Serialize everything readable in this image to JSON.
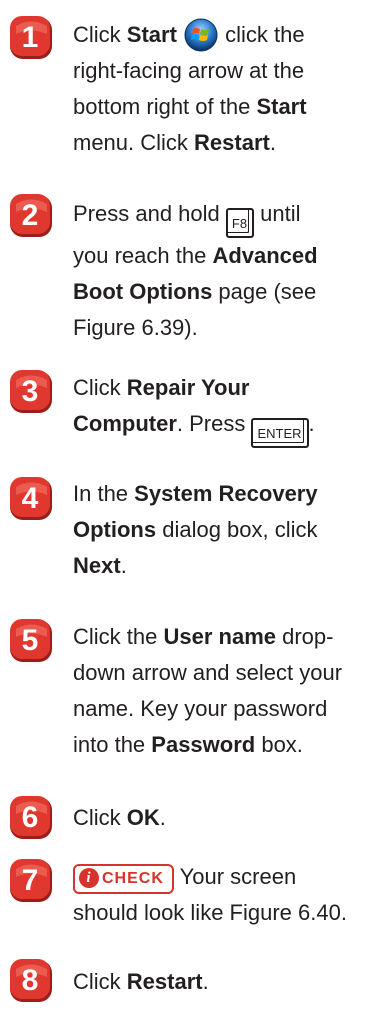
{
  "steps": [
    {
      "number": "1",
      "parts": [
        [
          "Click ",
          false
        ],
        [
          "Start",
          true
        ]
      ],
      "after_icon": [
        [
          " click the",
          false
        ]
      ],
      "lines": [
        [
          [
            "right-facing arrow at the",
            false
          ]
        ],
        [
          [
            "bottom right of the ",
            false
          ],
          [
            "Start",
            true
          ]
        ],
        [
          [
            "menu. Click ",
            false
          ],
          [
            "Restart",
            true
          ],
          [
            ".",
            false
          ]
        ]
      ]
    },
    {
      "number": "2"
    },
    {
      "number": "3"
    },
    {
      "number": "4"
    },
    {
      "number": "5"
    },
    {
      "number": "6"
    },
    {
      "number": "7"
    },
    {
      "number": "8"
    }
  ],
  "s1": {
    "l1a": "Click ",
    "l1b": "Start",
    "l1c": " click the",
    "l2": "right-facing arrow at the",
    "l3a": "bottom right of the ",
    "l3b": "Start",
    "l4a": "menu. Click ",
    "l4b": "Restart",
    "l4c": "."
  },
  "s2": {
    "l1a": "Press and hold ",
    "key": "F8",
    "l1b": " until",
    "l2a": "you reach the ",
    "l2b": "Advanced",
    "l3a": "Boot Options",
    "l3b": " page (see",
    "l4": "Figure 6.39)."
  },
  "s3": {
    "l1a": "Click ",
    "l1b": "Repair Your",
    "l2a": "Computer",
    "l2b": ". Press ",
    "key": "ENTER",
    "l2c": "."
  },
  "s4": {
    "l1a": "In the ",
    "l1b": "System Recovery",
    "l2a": "Options",
    "l2b": " dialog box, click",
    "l3a": "Next",
    "l3b": "."
  },
  "s5": {
    "l1a": "Click the ",
    "l1b": "User name",
    "l1c": " drop-",
    "l2": "down arrow and select your",
    "l3": "name. Key your password",
    "l4a": "into the ",
    "l4b": "Password",
    "l4c": " box."
  },
  "s6": {
    "l1a": "Click ",
    "l1b": "OK",
    "l1c": "."
  },
  "s7": {
    "badge": "CHECK",
    "badge_i": "i",
    "l1": " Your screen",
    "l2": "should look like Figure 6.40."
  },
  "s8": {
    "l1a": "Click ",
    "l1b": "Restart",
    "l1c": "."
  },
  "colors": {
    "badge_red": "#d7322b",
    "badge_dark": "#9c1e1a",
    "text": "#231f20"
  }
}
